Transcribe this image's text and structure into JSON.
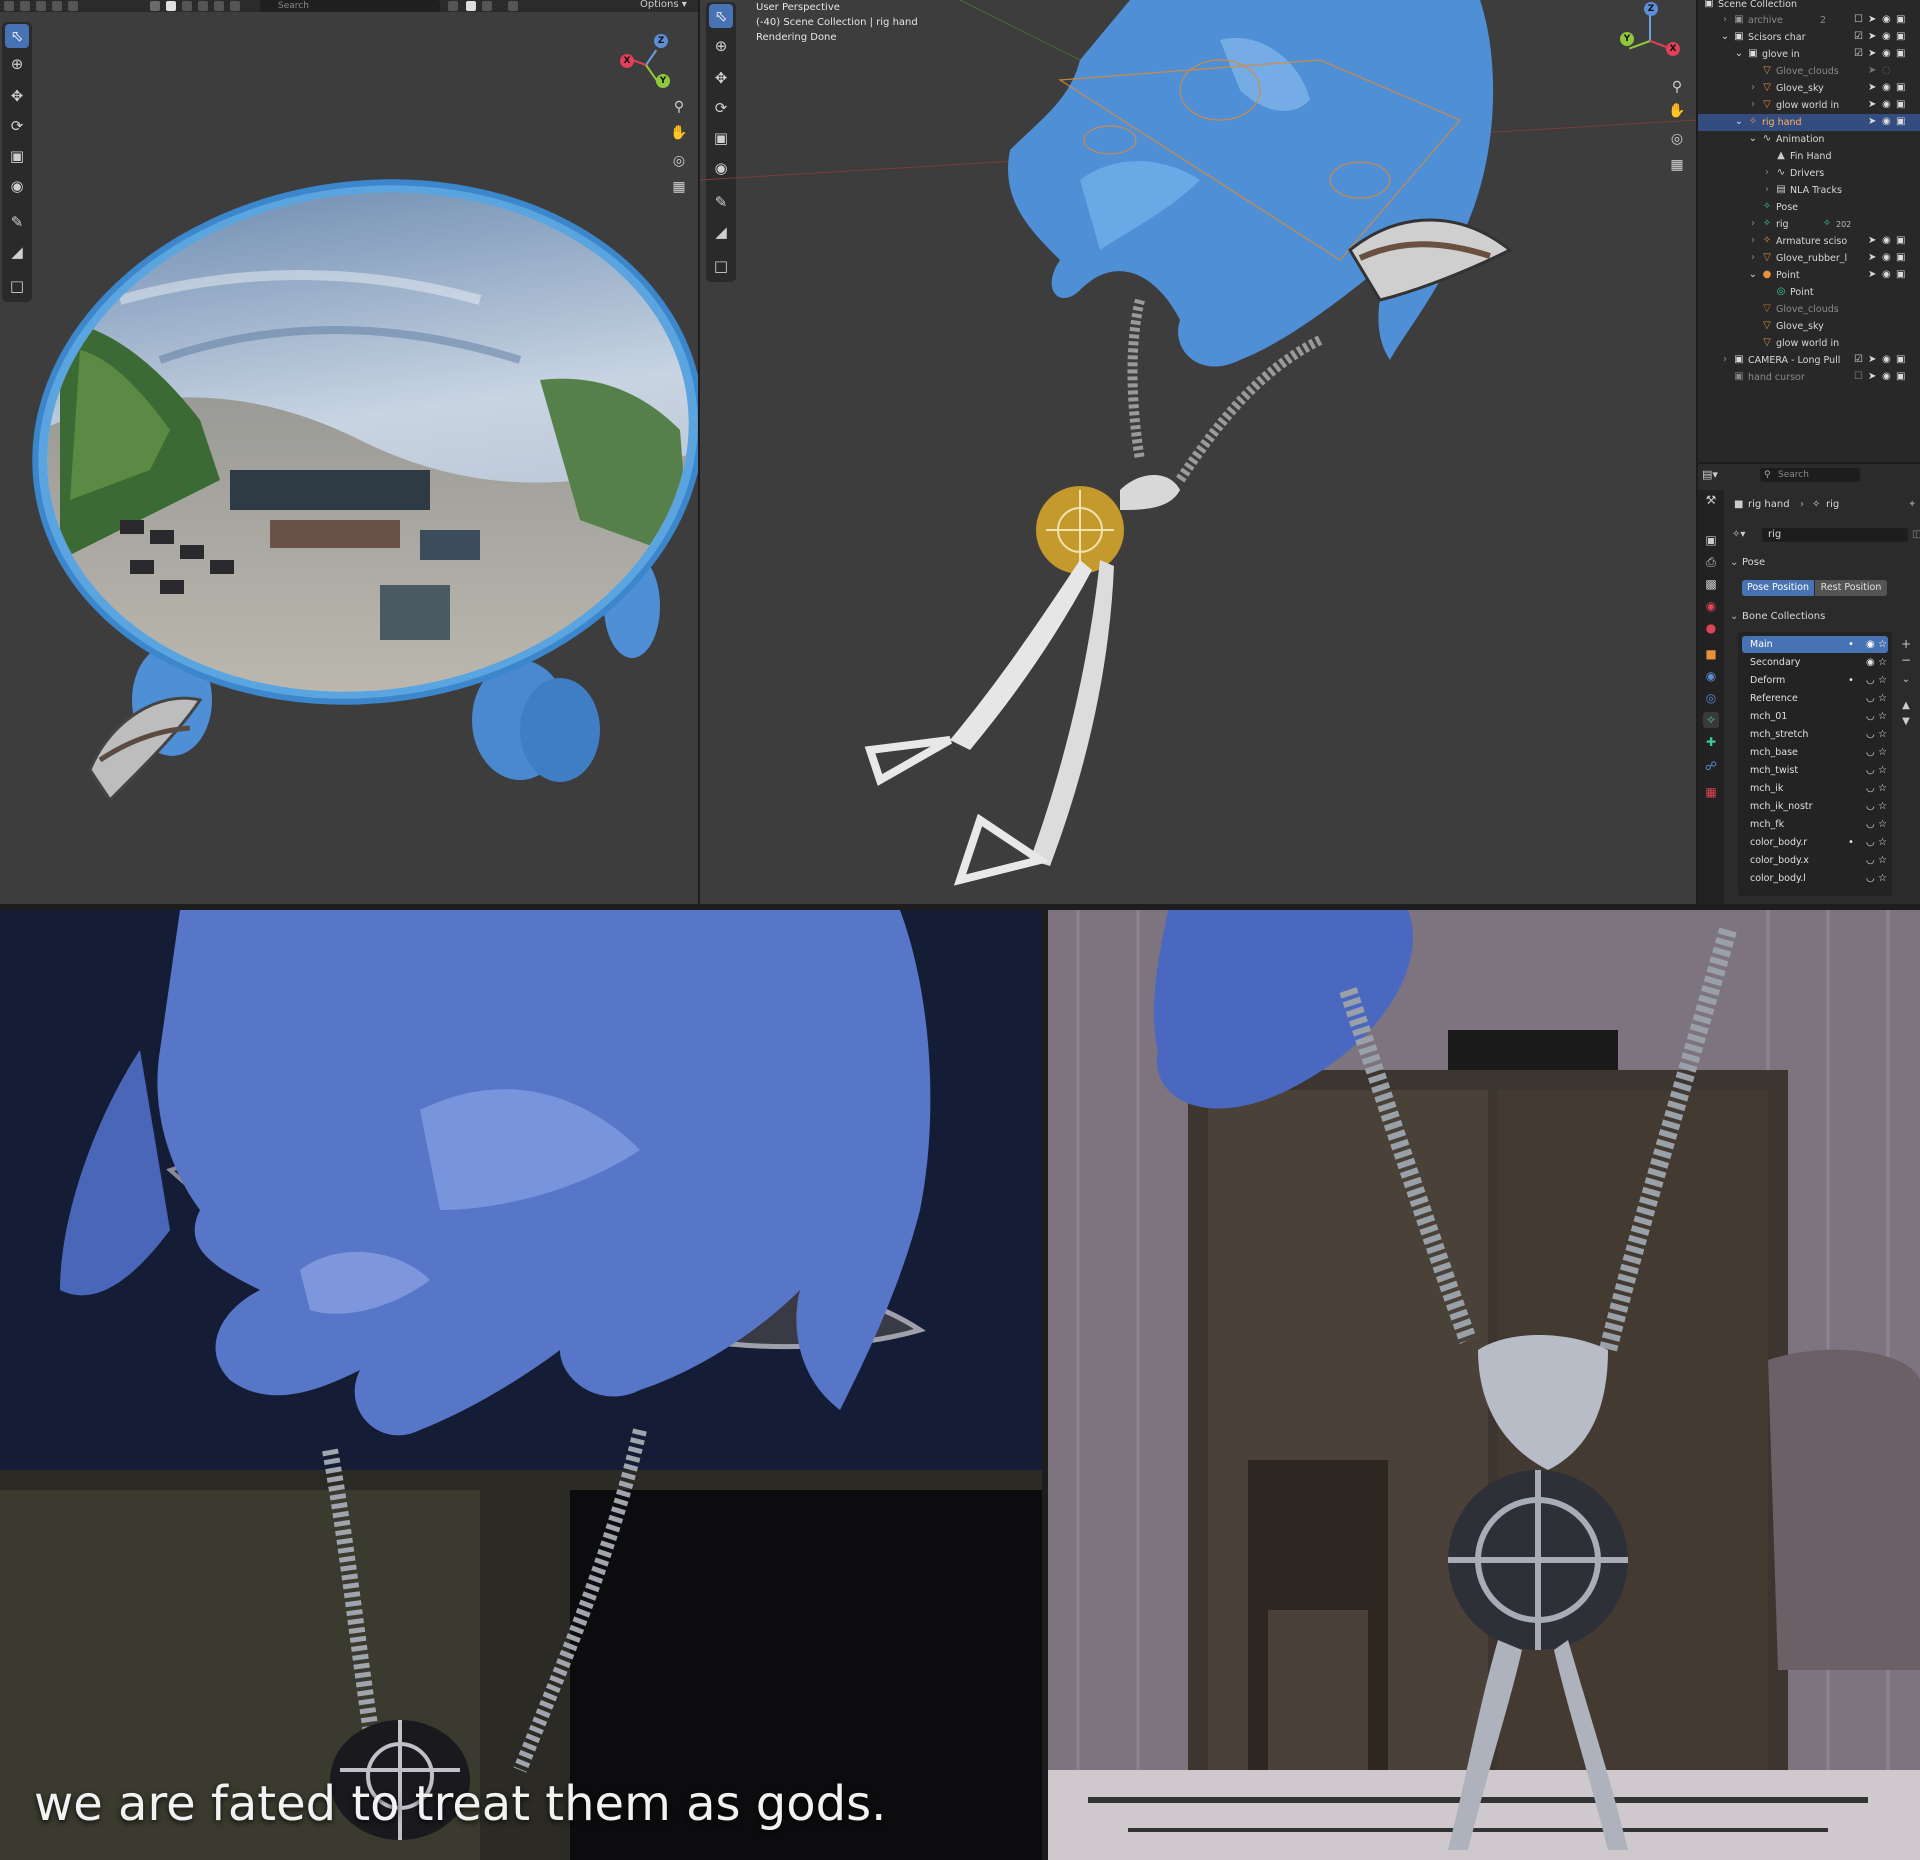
{
  "viewport_left": {
    "header": {
      "search_placeholder": "Search",
      "options_label": "Options"
    },
    "gizmo": {
      "x": "X",
      "y": "Y",
      "z": "Z"
    }
  },
  "viewport_main": {
    "overlay": {
      "line1": "User Perspective",
      "line2": "(-40) Scene Collection | rig hand",
      "line3": "Rendering Done"
    },
    "gizmo": {
      "x": "X",
      "y": "Y",
      "z": "Z"
    }
  },
  "outliner": {
    "title": "Scene Collection",
    "rows": [
      {
        "label": "archive",
        "dim": true,
        "badge": "2"
      },
      {
        "label": "Scisors char"
      },
      {
        "label": "glove in"
      },
      {
        "label": "Glove_clouds",
        "dim": true
      },
      {
        "label": "Glove_sky"
      },
      {
        "label": "glow world in"
      },
      {
        "label": "rig hand",
        "selected": true
      },
      {
        "label": "Animation"
      },
      {
        "label": "Fin Hand"
      },
      {
        "label": "Drivers"
      },
      {
        "label": "NLA Tracks"
      },
      {
        "label": "Pose"
      },
      {
        "label": "rig",
        "badge": "202"
      },
      {
        "label": "Armature sciso"
      },
      {
        "label": "Glove_rubber_l"
      },
      {
        "label": "Point"
      },
      {
        "label": "Point"
      },
      {
        "label": "Glove_clouds",
        "dim": true
      },
      {
        "label": "Glove_sky"
      },
      {
        "label": "glow world in"
      },
      {
        "label": "CAMERA - Long Pull"
      },
      {
        "label": "hand cursor",
        "dim": true
      }
    ]
  },
  "properties": {
    "search_placeholder": "Search",
    "breadcrumb": {
      "object": "rig hand",
      "data": "rig"
    },
    "data_name": "rig",
    "pose": {
      "section_label": "Pose",
      "pose_position": "Pose Position",
      "rest_position": "Rest Position"
    },
    "bone_collections": {
      "section_label": "Bone Collections",
      "items": [
        {
          "label": "Main",
          "active": true,
          "dot": true
        },
        {
          "label": "Secondary"
        },
        {
          "label": "Deform",
          "dot": true
        },
        {
          "label": "Reference"
        },
        {
          "label": "mch_01"
        },
        {
          "label": "mch_stretch"
        },
        {
          "label": "mch_base"
        },
        {
          "label": "mch_twist"
        },
        {
          "label": "mch_ik"
        },
        {
          "label": "mch_ik_nostr"
        },
        {
          "label": "mch_fk"
        },
        {
          "label": "color_body.r",
          "dot": true
        },
        {
          "label": "color_body.x"
        },
        {
          "label": "color_body.l"
        }
      ]
    }
  },
  "renders": {
    "subtitle": "we are fated to treat them as gods."
  },
  "colors": {
    "accent": "#4772b3",
    "selection": "#334d80",
    "viewport_bg": "#3d3d3d",
    "glove_blue": "#4f8fd6"
  }
}
